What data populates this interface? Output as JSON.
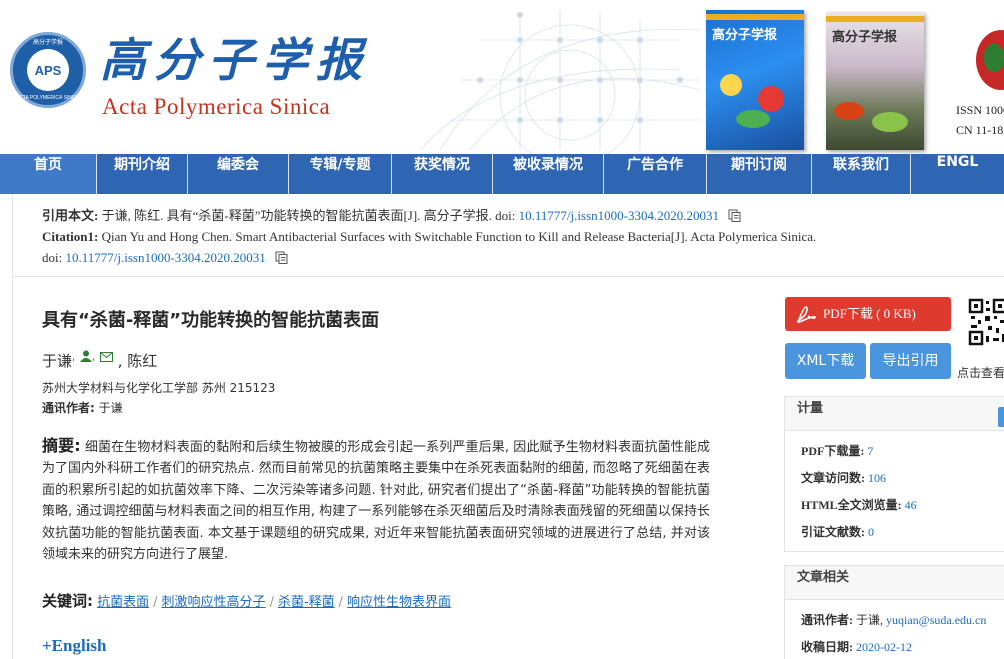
{
  "header": {
    "logo_text": "APS",
    "logo_ring_top": "高分子学报",
    "logo_ring_bottom": "ACTA POLYMERICA SINICA",
    "brand_cn": "高分子学报",
    "brand_en": "Acta Polymerica Sinica",
    "cover1_title": "高分子学报",
    "cover2_title": "高分子学报",
    "issn_line1": "ISSN 1000",
    "issn_line2": "CN 11-18"
  },
  "nav": {
    "items": [
      {
        "label": "首页"
      },
      {
        "label": "期刊介绍"
      },
      {
        "label": "编委会"
      },
      {
        "label": "专辑/专题"
      },
      {
        "label": "获奖情况"
      },
      {
        "label": "被收录情况"
      },
      {
        "label": "广告合作"
      },
      {
        "label": "期刊订阅"
      },
      {
        "label": "联系我们"
      },
      {
        "label": "ENGL"
      }
    ]
  },
  "citation": {
    "cn_label": "引用本文:",
    "cn_text": " 于谦, 陈红. 具有“杀菌-释菌”功能转换的智能抗菌表面[J]. 高分子学报. doi: ",
    "cn_doi": "10.11777/j.issn1000-3304.2020.20031",
    "en_label": "Citation1:",
    "en_text": " Qian Yu and Hong Chen. Smart Antibacterial Surfaces with Switchable Function to Kill and Release Bacteria[J]. Acta Polymerica Sinica.",
    "en_doi_prefix": "doi: ",
    "en_doi": "10.11777/j.issn1000-3304.2020.20031"
  },
  "article": {
    "title": "具有“杀菌-释菌”功能转换的智能抗菌表面",
    "author1": "于谦",
    "author_sep": ",",
    "author2": "陈红",
    "affiliation": "苏州大学材料与化学化工学部 苏州 215123",
    "corr_label": "通讯作者:",
    "corr_name": " 于谦",
    "abstract_label": "摘要:",
    "abstract_text": " 细菌在生物材料表面的黏附和后续生物被膜的形成会引起一系列严重后果, 因此赋予生物材料表面抗菌性能成为了国内外科研工作者们的研究热点. 然而目前常见的抗菌策略主要集中在杀死表面黏附的细菌, 而忽略了死细菌在表面的积累所引起的如抗菌效率下降、二次污染等诸多问题. 针对此, 研究者们提出了“杀菌-释菌”功能转换的智能抗菌策略, 通过调控细菌与材料表面之间的相互作用, 构建了一系列能够在杀灭细菌后及时清除表面残留的死细菌以保持长效抗菌功能的智能抗菌表面. 本文基于课题组的研究成果, 对近年来智能抗菌表面研究领域的进展进行了总结, 并对该领域未来的研究方向进行了展望.",
    "keywords_label": "关键词:",
    "keywords": [
      "抗菌表面",
      "刺激响应性高分子",
      "杀菌-释菌",
      "响应性生物表界面"
    ],
    "kw_sep": "/",
    "english_toggle": "+English"
  },
  "sidebar": {
    "pdf_label": "PDF下载 ( 0 KB)",
    "xml_label": "XML下载",
    "export_label": "导出引用",
    "qr_caption": "点击查看",
    "stats_title": "计量",
    "stats": [
      {
        "label": "PDF下载量:",
        "value": "7"
      },
      {
        "label": "文章访问数:",
        "value": "106"
      },
      {
        "label": "HTML全文浏览量:",
        "value": "46"
      },
      {
        "label": "引证文献数:",
        "value": "0"
      }
    ],
    "related_title": "文章相关",
    "related": [
      {
        "label": "通讯作者:",
        "value": " 于谦, ",
        "link": "yuqian@suda.edu.cn"
      },
      {
        "label": "收稿日期:",
        "value": "",
        "link": "2020-02-12"
      }
    ]
  },
  "colors": {
    "nav_bg": "#2e66b3",
    "link": "#1a6bc2",
    "pdf_btn": "#de3a2e",
    "blue_btn": "#4b95de",
    "brand_blue": "#1d5fae",
    "brand_red": "#c7321e"
  }
}
